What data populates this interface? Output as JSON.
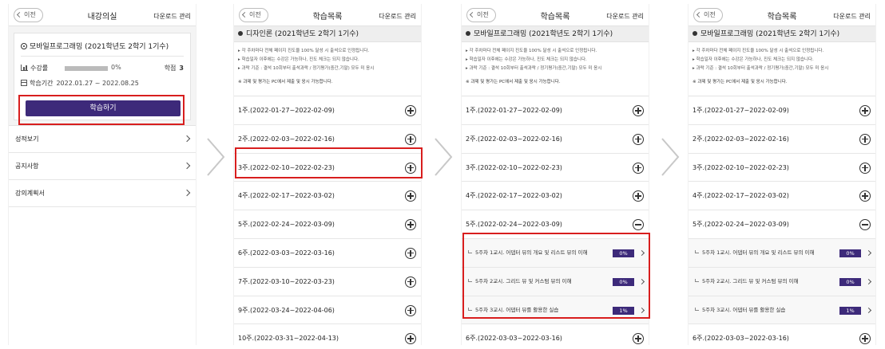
{
  "common": {
    "back_label": "이전",
    "download_label": "다운로드 관리",
    "list_title": "학습목록"
  },
  "screen1": {
    "title": "내강의실",
    "course_title": "모바일프로그래밍 (2021학년도 2학기 1기수)",
    "progress_label": "수강률",
    "progress_value": "0%",
    "progress_fraction": 0,
    "credit_label": "학점",
    "credit_value": "3",
    "period_label": "학습기간",
    "period_value": "2022.01.27 ~ 2022.08.25",
    "study_button": "학습하기",
    "menu": [
      "성적보기",
      "공지사항",
      "강의계획서"
    ]
  },
  "screen2": {
    "section_title": "디자인론 (2021학년도 2학기 1기수)",
    "notice": [
      "▸ 각 주차마다 전체 페이지 진도율 100% 달성 시 출석으로 인정됩니다.",
      "▸ 학습일자 이후에는 수강은 가능하나, 진도 체크는 되지 않습니다.",
      "▸ 과락 기준 : 결석 10회부터 출석과락 / 정기평가(중간,기말) 모두 미 응시",
      "※ 과제 및 평가는 PC에서 제출 및 응시 가능합니다."
    ],
    "weeks": [
      "1주.(2022-01-27~2022-02-09)",
      "2주.(2022-02-03~2022-02-16)",
      "3주.(2022-02-10~2022-02-23)",
      "4주.(2022-02-17~2022-03-02)",
      "5주.(2022-02-24~2022-03-09)",
      "6주.(2022-03-03~2022-03-16)",
      "7주.(2022-03-10~2022-03-23)",
      "9주.(2022-03-24~2022-04-06)",
      "10주.(2022-03-31~2022-04-13)"
    ]
  },
  "screen3": {
    "section_title": "모바일프로그래밍 (2021학년도 2학기 1기수)",
    "weeks": [
      "1주.(2022-01-27~2022-02-09)",
      "2주.(2022-02-03~2022-02-16)",
      "3주.(2022-02-10~2022-02-23)",
      "4주.(2022-02-17~2022-03-02)",
      "5주.(2022-02-24~2022-03-09)"
    ],
    "lessons": [
      {
        "label": "5주차 1교시. 어댑터 뷰의 개요 및 리스트 뷰의 이해",
        "pct": "0%"
      },
      {
        "label": "5주차 2교시. 그리드 뷰 및 커스텀 뷰의 이해",
        "pct": "0%"
      },
      {
        "label": "5주차 3교시. 어댑터 뷰를 활용한 실습",
        "pct": "1%"
      }
    ],
    "after_week": "6주.(2022-03-03~2022-03-16)"
  },
  "colors": {
    "accent": "#3d2a7a",
    "highlight": "#d81e1e"
  }
}
